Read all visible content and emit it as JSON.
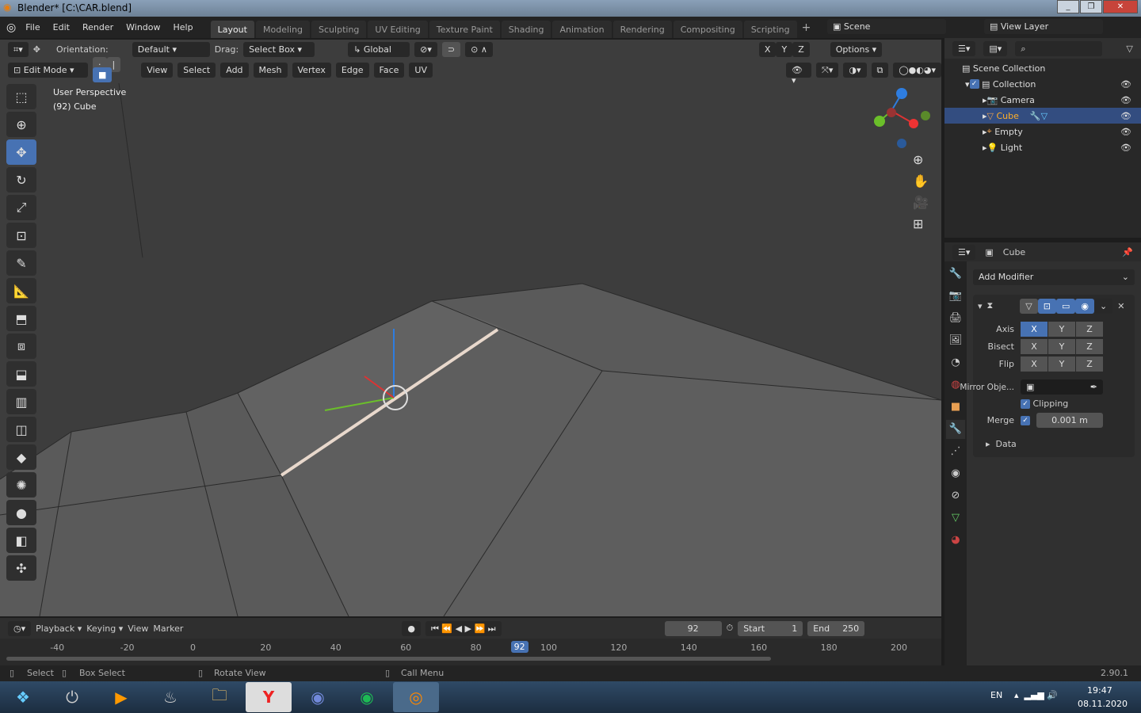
{
  "window": {
    "title": "Blender* [C:\\CAR.blend]"
  },
  "menu": [
    "File",
    "Edit",
    "Render",
    "Window",
    "Help"
  ],
  "workspaces": [
    "Layout",
    "Modeling",
    "Sculpting",
    "UV Editing",
    "Texture Paint",
    "Shading",
    "Animation",
    "Rendering",
    "Compositing",
    "Scripting"
  ],
  "active_workspace": "Layout",
  "scene": "Scene",
  "view_layer": "View Layer",
  "header": {
    "orientation_label": "Orientation:",
    "orientation": "Default",
    "drag_label": "Drag:",
    "drag": "Select Box",
    "transform": "Global",
    "options": "Options",
    "axes": [
      "X",
      "Y",
      "Z"
    ]
  },
  "edit_header": {
    "mode": "Edit Mode",
    "menus": [
      "View",
      "Select",
      "Add",
      "Mesh",
      "Vertex",
      "Edge",
      "Face",
      "UV"
    ]
  },
  "viewport": {
    "perspective": "User Perspective",
    "object": "(92) Cube",
    "gizmo_axes": [
      "X",
      "Y",
      "Z"
    ]
  },
  "outliner": {
    "root": "Scene Collection",
    "collection": "Collection",
    "items": [
      {
        "name": "Camera",
        "selected": false
      },
      {
        "name": "Cube",
        "selected": true
      },
      {
        "name": "Empty",
        "selected": false
      },
      {
        "name": "Light",
        "selected": false
      }
    ]
  },
  "properties": {
    "object": "Cube",
    "add_modifier": "Add Modifier",
    "axis_label": "Axis",
    "bisect_label": "Bisect",
    "flip_label": "Flip",
    "xyz": [
      "X",
      "Y",
      "Z"
    ],
    "mirror_object_label": "Mirror Obje...",
    "clipping_label": "Clipping",
    "clipping": true,
    "merge_label": "Merge",
    "merge": true,
    "merge_value": "0.001 m",
    "data_label": "Data",
    "axis_active": "X"
  },
  "timeline": {
    "menus": [
      "Playback",
      "Keying",
      "View",
      "Marker"
    ],
    "current_frame": "92",
    "start_label": "Start",
    "start": "1",
    "end_label": "End",
    "end": "250",
    "ticks": [
      "-40",
      "-20",
      "0",
      "20",
      "40",
      "60",
      "80",
      "100",
      "120",
      "140",
      "160",
      "180",
      "200"
    ]
  },
  "status": {
    "select": "Select",
    "box_select": "Box Select",
    "rotate": "Rotate View",
    "call_menu": "Call Menu",
    "version": "2.90.1"
  },
  "taskbar": {
    "lang": "EN",
    "time": "19:47",
    "date": "08.11.2020"
  },
  "colors": {
    "accent": "#4772b3",
    "selected_text": "#ffaf29"
  }
}
